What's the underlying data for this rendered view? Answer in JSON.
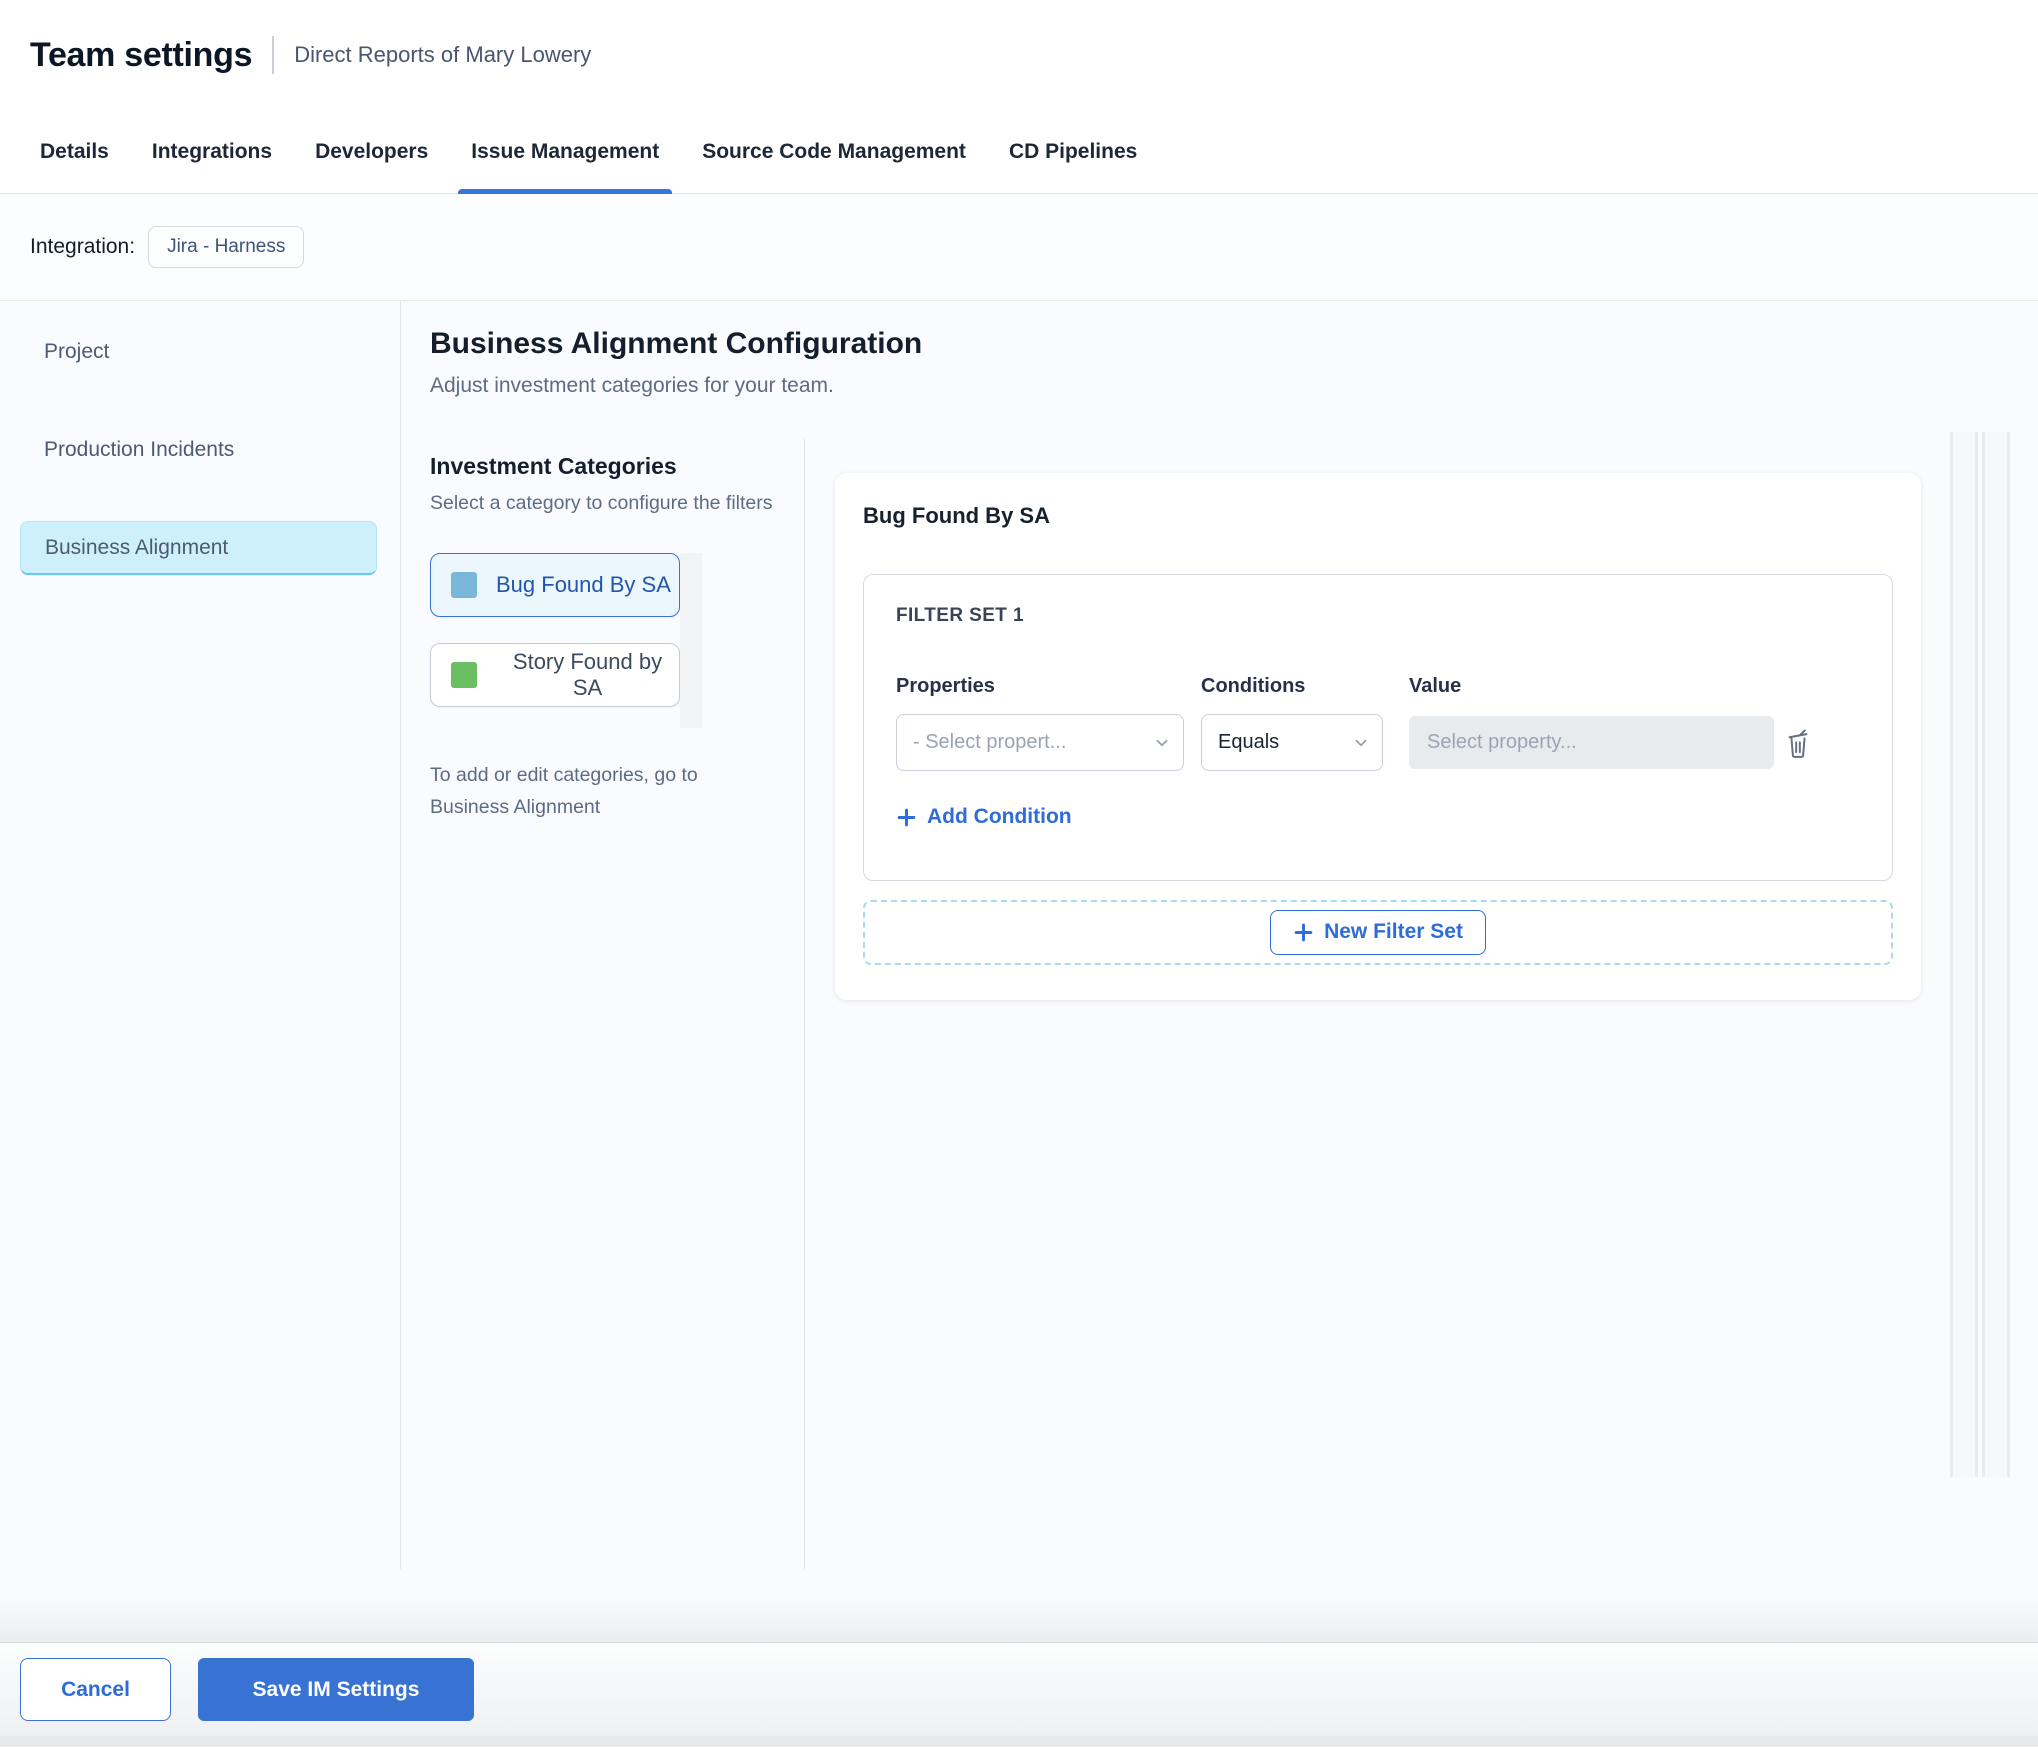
{
  "header": {
    "title": "Team settings",
    "subtitle": "Direct Reports of Mary Lowery"
  },
  "tabs": [
    {
      "label": "Details",
      "active": false
    },
    {
      "label": "Integrations",
      "active": false
    },
    {
      "label": "Developers",
      "active": false
    },
    {
      "label": "Issue Management",
      "active": true
    },
    {
      "label": "Source Code Management",
      "active": false
    },
    {
      "label": "CD Pipelines",
      "active": false
    }
  ],
  "integration": {
    "label": "Integration:",
    "chip": "Jira - Harness"
  },
  "sidebar": {
    "items": [
      {
        "label": "Project",
        "active": false
      },
      {
        "label": "Production Incidents",
        "active": false
      },
      {
        "label": "Business Alignment",
        "active": true
      }
    ]
  },
  "main": {
    "heading": "Business Alignment Configuration",
    "subheading": "Adjust investment categories for your team.",
    "categories": {
      "title": "Investment Categories",
      "help": "Select a category to configure the filters",
      "items": [
        {
          "label": "Bug Found By SA",
          "color": "#79b7d8",
          "selected": true
        },
        {
          "label": "Story Found by SA",
          "color": "#6abf62",
          "selected": false
        }
      ],
      "footnote": "To add or edit categories, go to Business Alignment"
    },
    "panel": {
      "title": "Bug Found By SA",
      "filter_set": {
        "label": "FILTER SET 1",
        "columns": [
          "Properties",
          "Conditions",
          "Value"
        ],
        "condition": {
          "property_placeholder": "- Select propert...",
          "condition_value": "Equals",
          "value_placeholder": "Select property..."
        },
        "add_condition_label": "Add Condition"
      },
      "new_filter_set_label": "New Filter Set"
    }
  },
  "footer": {
    "cancel_label": "Cancel",
    "save_label": "Save IM Settings"
  },
  "icons": {
    "dropdown": "chevron-down-icon",
    "delete": "trash-icon",
    "add": "plus-icon"
  },
  "colors": {
    "accent_blue": "#2e6cd9",
    "tab_underline": "#3b74d8",
    "save_button_bg": "#3873d3",
    "active_nav_bg": "#cdf0fc",
    "category_blue": "#79b7d8",
    "category_green": "#6abf62"
  }
}
